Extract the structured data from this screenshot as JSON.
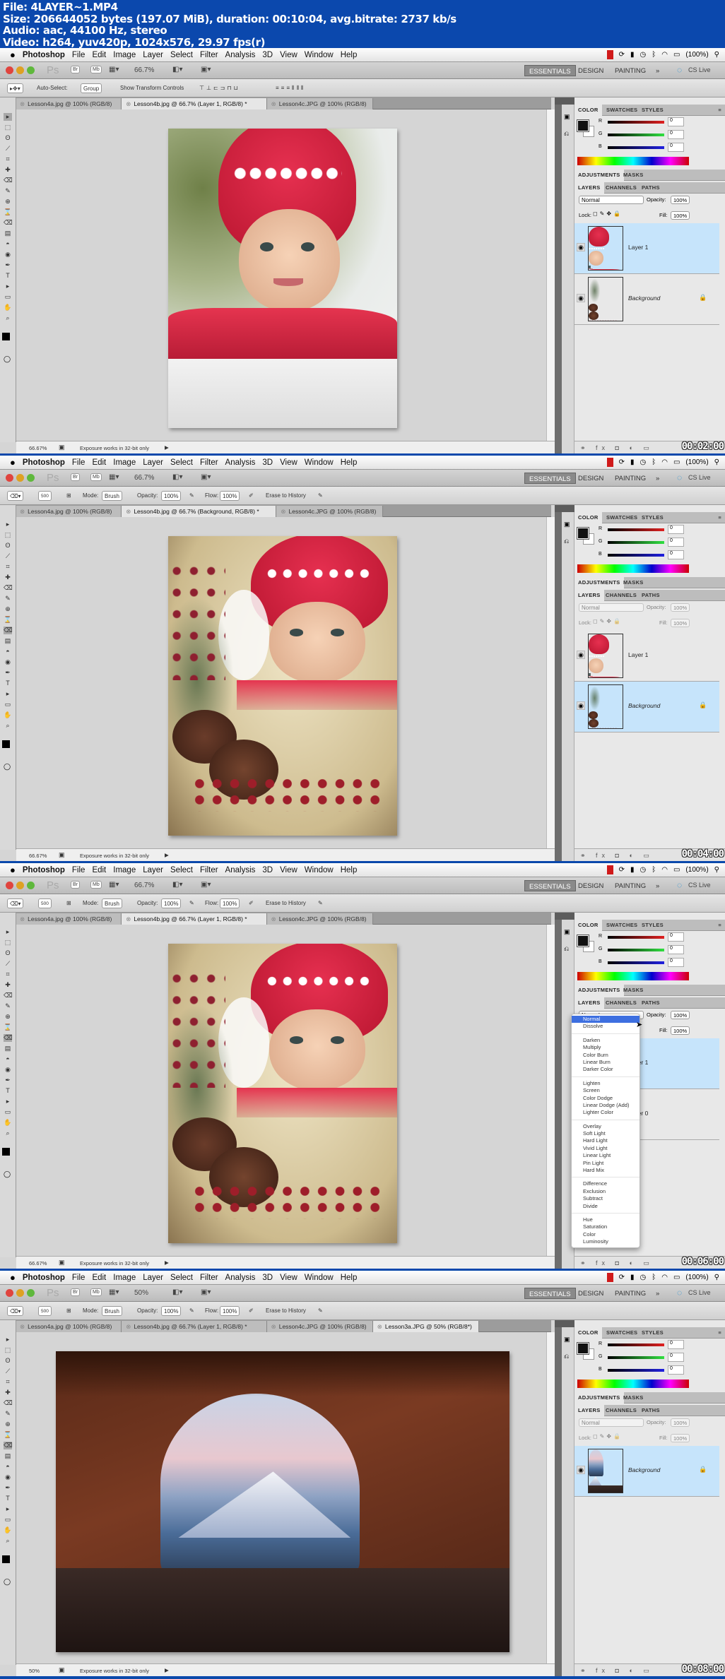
{
  "header": {
    "lines": [
      "File: 4LAYER~1.MP4",
      "Size: 206644052 bytes (197.07 MiB), duration: 00:10:04, avg.bitrate: 2737 kb/s",
      "Audio: aac, 44100 Hz, stereo",
      "Video: h264, yuv420p, 1024x576, 29.97 fps(r)"
    ]
  },
  "menubar": {
    "items": [
      "Photoshop",
      "File",
      "Edit",
      "Image",
      "Layer",
      "Select",
      "Filter",
      "Analysis",
      "3D",
      "View",
      "Window",
      "Help"
    ],
    "battery": "(100%)"
  },
  "appbar": {
    "ps_logo": "Ps",
    "bridge": "Br",
    "mini_bridge": "Mb",
    "workspaces": [
      "ESSENTIALS",
      "DESIGN",
      "PAINTING"
    ],
    "more": "»",
    "cs_live": "CS Live"
  },
  "move_options": {
    "auto_select": "Auto-Select:",
    "group": "Group",
    "show_transform": "Show Transform Controls"
  },
  "eraser_options": {
    "size": "500",
    "mode_label": "Mode:",
    "mode": "Brush",
    "opacity_label": "Opacity:",
    "opacity": "100%",
    "flow_label": "Flow:",
    "flow": "100%",
    "erase_history": "Erase to History"
  },
  "panels": {
    "color_tabs": [
      "COLOR",
      "SWATCHES",
      "STYLES"
    ],
    "channels": [
      {
        "label": "R",
        "value": "0"
      },
      {
        "label": "G",
        "value": "0"
      },
      {
        "label": "B",
        "value": "0"
      }
    ],
    "adj_tabs": [
      "ADJUSTMENTS",
      "MASKS"
    ],
    "layer_tabs": [
      "LAYERS",
      "CHANNELS",
      "PATHS"
    ],
    "blend": "Normal",
    "opacity_label": "Opacity:",
    "opacity": "100%",
    "lock_label": "Lock:",
    "fill_label": "Fill:",
    "fill": "100%"
  },
  "status_message": "Exposure works in 32-bit only",
  "blend_modes": [
    [
      "Normal",
      "Dissolve"
    ],
    [
      "Darken",
      "Multiply",
      "Color Burn",
      "Linear Burn",
      "Darker Color"
    ],
    [
      "Lighten",
      "Screen",
      "Color Dodge",
      "Linear Dodge (Add)",
      "Lighter Color"
    ],
    [
      "Overlay",
      "Soft Light",
      "Hard Light",
      "Vivid Light",
      "Linear Light",
      "Pin Light",
      "Hard Mix"
    ],
    [
      "Difference",
      "Exclusion",
      "Subtract",
      "Divide"
    ],
    [
      "Hue",
      "Saturation",
      "Color",
      "Luminosity"
    ]
  ],
  "frames": [
    {
      "tool": "move",
      "zoom": "66.7%",
      "status_zoom": "66.67%",
      "timestamp": "00:02:00",
      "tabs": [
        "Lesson4a.jpg @ 100% (RGB/8)",
        "Lesson4b.jpg @ 66.7% (Layer 1, RGB/8) *",
        "Lesson4c.JPG @ 100% (RGB/8)"
      ],
      "active_tab": 1,
      "image": "girl",
      "panel_disabled": false,
      "layers": [
        {
          "name": "Layer 1",
          "selected": true,
          "thumb": "girl"
        },
        {
          "name": "Background",
          "selected": false,
          "thumb": "frame",
          "locked": true
        }
      ]
    },
    {
      "tool": "eraser",
      "zoom": "66.7%",
      "status_zoom": "66.67%",
      "timestamp": "00:04:00",
      "tabs": [
        "Lesson4a.jpg @ 100% (RGB/8)",
        "Lesson4b.jpg @ 66.7% (Background, RGB/8) *",
        "Lesson4c.JPG @ 100% (RGB/8)"
      ],
      "active_tab": 1,
      "image": "composite",
      "panel_disabled": true,
      "layers": [
        {
          "name": "Layer 1",
          "selected": false,
          "thumb": "girl-erased"
        },
        {
          "name": "Background",
          "selected": true,
          "thumb": "frame",
          "locked": true
        }
      ]
    },
    {
      "tool": "eraser",
      "zoom": "66.7%",
      "status_zoom": "66.67%",
      "timestamp": "00:06:00",
      "tabs": [
        "Lesson4a.jpg @ 100% (RGB/8)",
        "Lesson4b.jpg @ 66.7% (Layer 1, RGB/8) *",
        "Lesson4c.JPG @ 100% (RGB/8)"
      ],
      "active_tab": 1,
      "image": "composite",
      "panel_disabled": false,
      "dropdown_open": true,
      "dropdown_selected": "Normal",
      "layers": [
        {
          "name": "Layer 1",
          "selected": true,
          "thumb": "girl-erased"
        },
        {
          "name": "Layer 0",
          "selected": false,
          "thumb": "frame"
        }
      ]
    },
    {
      "tool": "eraser",
      "zoom": "50%",
      "status_zoom": "50%",
      "timestamp": "00:08:00",
      "tabs": [
        "Lesson4a.jpg @ 100% (RGB/8)",
        "Lesson4b.jpg @ 66.7% (Layer 1, RGB/8) *",
        "Lesson4c.JPG @ 100% (RGB/8)",
        "Lesson3a.JPG @ 50% (RGB/8*)"
      ],
      "active_tab": 3,
      "image": "arch",
      "panel_disabled": true,
      "layers": [
        {
          "name": "Background",
          "selected": true,
          "thumb": "arch",
          "locked": true
        }
      ]
    }
  ],
  "colors": {
    "header_bg": "#0b48ad",
    "selected_layer": "#c6e4fb",
    "menu_highlight": "#3d6fe0",
    "hat_red": "#d8223f"
  }
}
